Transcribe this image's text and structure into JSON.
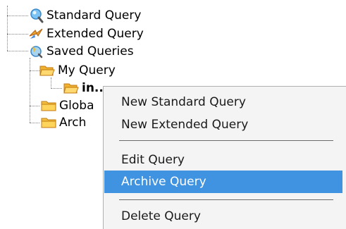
{
  "tree": {
    "items": [
      {
        "label": "Standard Query",
        "icon": "magnifier-icon",
        "bold": false
      },
      {
        "label": "Extended Query",
        "icon": "arrows-icon",
        "bold": false
      },
      {
        "label": "Saved Queries",
        "icon": "saved-queries-icon",
        "bold": false
      },
      {
        "label": "My Query",
        "icon": "open-folder-icon",
        "bold": false
      },
      {
        "label": "in...i",
        "icon": "open-folder-icon",
        "bold": true
      },
      {
        "label": "Globa",
        "icon": "folder-icon",
        "bold": false
      },
      {
        "label": "Arch",
        "icon": "folder-icon",
        "bold": false
      }
    ]
  },
  "context_menu": {
    "items": [
      {
        "label": "New Standard Query"
      },
      {
        "label": "New Extended Query"
      },
      {
        "label": "Edit Query"
      },
      {
        "label": "Archive Query",
        "highlighted": true
      },
      {
        "label": "Delete Query"
      }
    ],
    "highlight_color": "#3f93e0",
    "background_color": "#f4f4f4"
  }
}
